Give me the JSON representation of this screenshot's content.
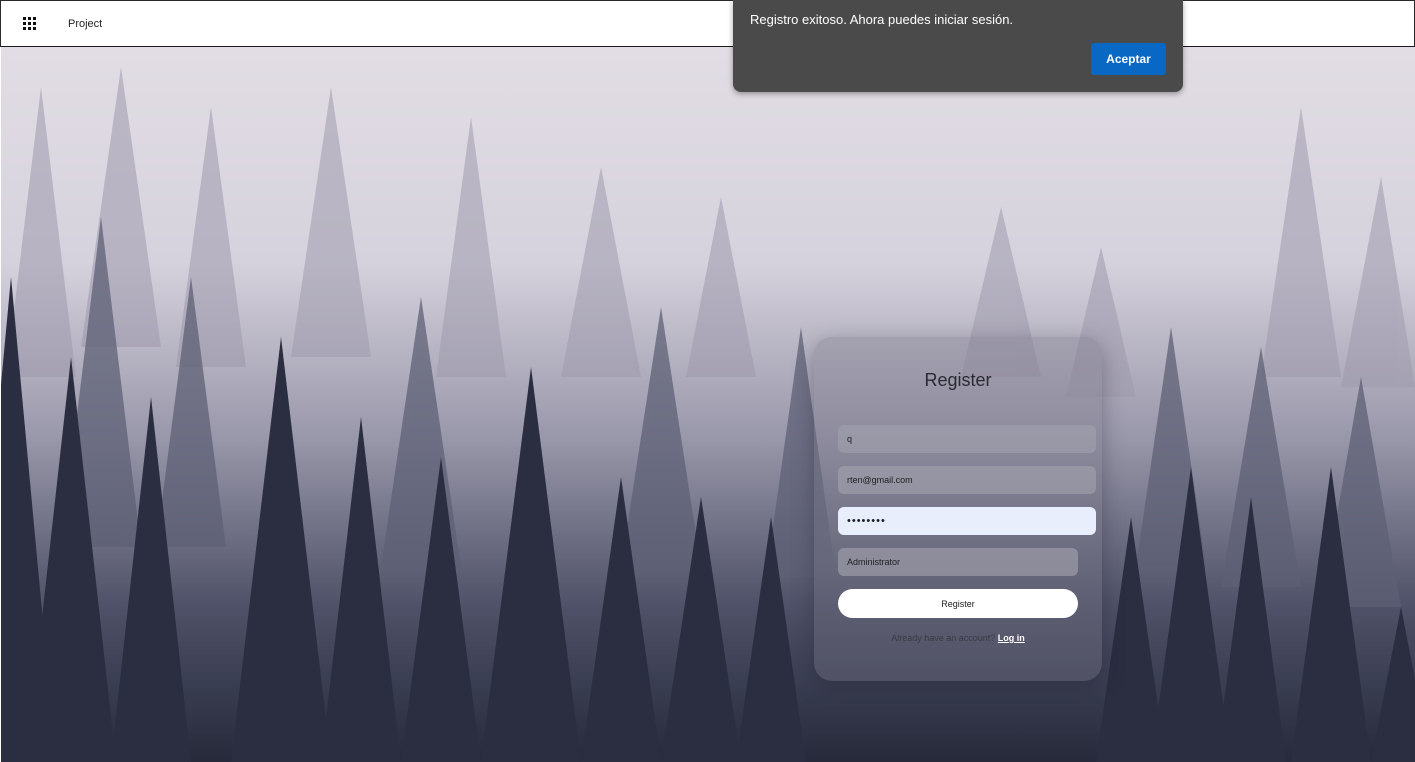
{
  "header": {
    "apps_icon": "grid-icon",
    "title": "Project"
  },
  "toast": {
    "message": "Registro exitoso. Ahora puedes iniciar sesión.",
    "accept_label": "Aceptar"
  },
  "register_form": {
    "title": "Register",
    "name_value": "q",
    "email_value": "rten@gmail.com",
    "password_value": "••••••••",
    "role_value": "Administrator",
    "submit_label": "Register",
    "login_prompt": "Already have an account?",
    "login_link": "Log in"
  },
  "colors": {
    "accent_button": "#0868c4",
    "toast_background": "#4a4a4a"
  }
}
